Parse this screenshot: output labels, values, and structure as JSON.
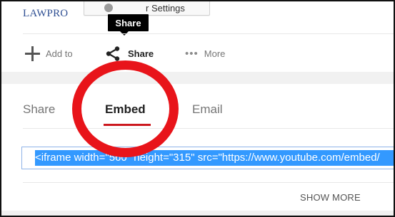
{
  "top": {
    "logo": "LAWPRO",
    "settings_button_label": "r Settings",
    "tooltip": "Share"
  },
  "actions": [
    {
      "label": "Add to",
      "icon": "plus-icon"
    },
    {
      "label": "Share",
      "icon": "share-icon"
    },
    {
      "label": "More",
      "icon": "more-icon"
    }
  ],
  "tabs": [
    {
      "label": "Share",
      "active": false
    },
    {
      "label": "Embed",
      "active": true
    },
    {
      "label": "Email",
      "active": false
    }
  ],
  "embed": {
    "code": "<iframe width=\"560\" height=\"315\" src=\"https://www.youtube.com/embed/"
  },
  "footer": {
    "show_more": "SHOW MORE"
  },
  "colors": {
    "active_tab_underline": "#cc181e",
    "selection_highlight": "#3399ff",
    "annotation_circle": "#e8141a"
  }
}
